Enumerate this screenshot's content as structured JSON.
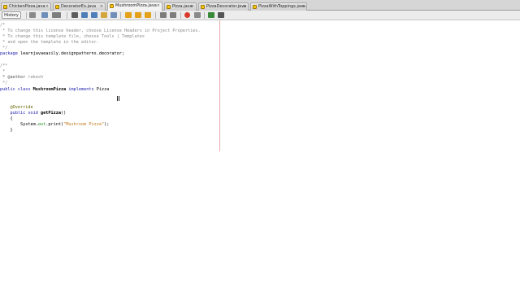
{
  "tabs": [
    {
      "label": "ChickenPizza.java",
      "active": false
    },
    {
      "label": "DecoratorEx.java",
      "active": false
    },
    {
      "label": "MushroomPizza.java",
      "active": true
    },
    {
      "label": "Pizza.java",
      "active": false
    },
    {
      "label": "PizzaDecorator.java",
      "active": false
    },
    {
      "label": "PizzaWithToppings.java",
      "active": false
    }
  ],
  "toolbar": {
    "history_label": "History"
  },
  "code": {
    "c1": "/*",
    "c2": " * To change this license header, choose License Headers in Project Properties.",
    "c3": " * To change this template file, choose Tools | Templates",
    "c4": " * and open the template in the editor.",
    "c5": " */",
    "pkg_kw": "package",
    "pkg_name": " learnjavaeasily.designpatterns.decorator;",
    "d1": "/**",
    "d2": " *",
    "d3_tag": " * @author",
    "d3_val": " rakesh",
    "d4": " */",
    "cls_kw1": "public class",
    "cls_name": " MushroomPizza",
    "cls_kw2": " implements",
    "cls_iface": " Pizza",
    "override": "    @Override",
    "m_kw": "    public void",
    "m_name": " getPizza",
    "m_paren": "()",
    "open_brace": "    {",
    "call_pre": "        System.",
    "call_out": "out",
    "call_mid": ".print(",
    "call_str": "\"Mushroom Pizza\"",
    "call_end": ");",
    "close_brace": "    }"
  }
}
